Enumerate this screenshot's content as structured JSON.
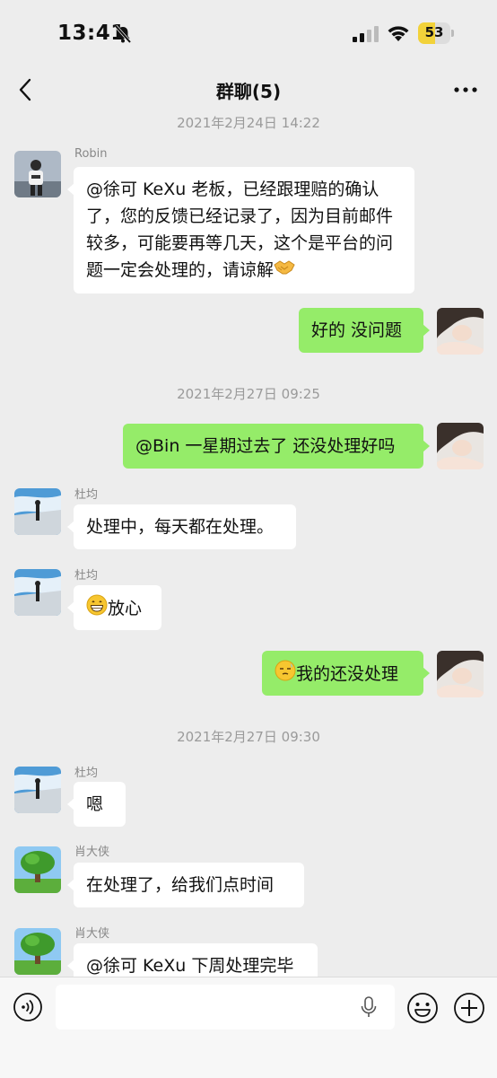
{
  "status_bar": {
    "time": "13:41",
    "battery_percent": "53",
    "icons": [
      "bell-muted-icon",
      "signal-icon",
      "wifi-icon",
      "battery-icon"
    ]
  },
  "nav": {
    "title": "群聊(5)",
    "back_icon": "chevron-left-icon",
    "more_icon": "more-dots-icon"
  },
  "colors": {
    "background": "#ededed",
    "incoming_bubble": "#ffffff",
    "outgoing_bubble": "#95ec69",
    "timestamp": "#9a9a9a",
    "battery": "#f2d23a"
  },
  "timestamps": [
    "2021年2月24日 14:22",
    "2021年2月27日 09:25",
    "2021年2月27日 09:30"
  ],
  "messages": [
    {
      "sender": "Robin",
      "text": "@徐可 KeXu 老板，已经跟理赔的确认了，您的反馈已经记录了，因为目前邮件较多，可能要再等几天，这个是平台的问题一定会处理的，请谅解",
      "emoji": "handshake-emoji"
    },
    {
      "sender": "",
      "text": "好的 没问题"
    },
    {
      "sender": "",
      "text": "@Bin 一星期过去了 还没处理好吗"
    },
    {
      "sender": "杜均",
      "text": "处理中，每天都在处理。"
    },
    {
      "sender": "杜均",
      "text": "放心",
      "emoji": "grinning-face-emoji"
    },
    {
      "sender": "",
      "text": "我的还没处理",
      "emoji": "sleepy-face-emoji"
    },
    {
      "sender": "杜均",
      "text": "嗯"
    },
    {
      "sender": "肖大侠",
      "text": "在处理了，给我们点时间"
    },
    {
      "sender": "肖大侠",
      "text": "@徐可 KeXu 下周处理完毕"
    }
  ],
  "input_bar": {
    "value": "",
    "icons": [
      "voice-icon",
      "mic-icon",
      "emoji-icon",
      "plus-icon"
    ]
  }
}
